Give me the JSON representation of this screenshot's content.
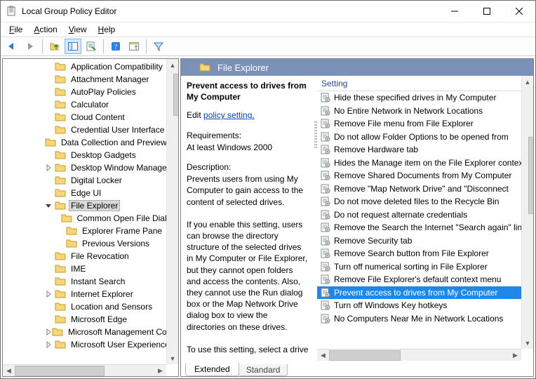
{
  "window": {
    "title": "Local Group Policy Editor"
  },
  "menu": {
    "file": "File",
    "action": "Action",
    "view": "View",
    "help": "Help"
  },
  "category": {
    "label": "File Explorer"
  },
  "desc": {
    "title": "Prevent access to drives from My Computer",
    "edit_prefix": "Edit ",
    "edit_link": "policy setting.",
    "req_header": "Requirements:",
    "req_value": "At least Windows 2000",
    "d_header": "Description:",
    "d_value": "Prevents users from using My Computer to gain access to the content of selected drives.\n\nIf you enable this setting, users can browse the directory structure of the selected drives in My Computer or File Explorer, but they cannot open folders and access the contents. Also, they cannot use the Run dialog box or the Map Network Drive dialog box to view the directories on these drives.\n\nTo use this setting, select a drive"
  },
  "list_header": "Setting",
  "tabs": {
    "extended": "Extended",
    "standard": "Standard"
  },
  "tree": [
    {
      "indent": 4,
      "label": "Application Compatibility",
      "expand": ""
    },
    {
      "indent": 4,
      "label": "Attachment Manager",
      "expand": ""
    },
    {
      "indent": 4,
      "label": "AutoPlay Policies",
      "expand": ""
    },
    {
      "indent": 4,
      "label": "Calculator",
      "expand": ""
    },
    {
      "indent": 4,
      "label": "Cloud Content",
      "expand": ""
    },
    {
      "indent": 4,
      "label": "Credential User Interface",
      "expand": ""
    },
    {
      "indent": 4,
      "label": "Data Collection and Preview Builds",
      "expand": ""
    },
    {
      "indent": 4,
      "label": "Desktop Gadgets",
      "expand": ""
    },
    {
      "indent": 4,
      "label": "Desktop Window Manager",
      "expand": ">"
    },
    {
      "indent": 4,
      "label": "Digital Locker",
      "expand": ""
    },
    {
      "indent": 4,
      "label": "Edge UI",
      "expand": ""
    },
    {
      "indent": 4,
      "label": "File Explorer",
      "expand": "v",
      "selected": true
    },
    {
      "indent": 5,
      "label": "Common Open File Dialog",
      "expand": ""
    },
    {
      "indent": 5,
      "label": "Explorer Frame Pane",
      "expand": ""
    },
    {
      "indent": 5,
      "label": "Previous Versions",
      "expand": ""
    },
    {
      "indent": 4,
      "label": "File Revocation",
      "expand": ""
    },
    {
      "indent": 4,
      "label": "IME",
      "expand": ""
    },
    {
      "indent": 4,
      "label": "Instant Search",
      "expand": ""
    },
    {
      "indent": 4,
      "label": "Internet Explorer",
      "expand": ">"
    },
    {
      "indent": 4,
      "label": "Location and Sensors",
      "expand": ""
    },
    {
      "indent": 4,
      "label": "Microsoft Edge",
      "expand": ""
    },
    {
      "indent": 4,
      "label": "Microsoft Management Console",
      "expand": ">"
    },
    {
      "indent": 4,
      "label": "Microsoft User Experience",
      "expand": ">"
    }
  ],
  "settings": [
    "Hide these specified drives in My Computer",
    "No Entire Network in Network Locations",
    "Remove File menu from File Explorer",
    "Do not allow Folder Options to be opened from",
    "Remove Hardware tab",
    "Hides the Manage item on the File Explorer context menu",
    "Remove Shared Documents from My Computer",
    "Remove \"Map Network Drive\" and \"Disconnect",
    "Do not move deleted files to the Recycle Bin",
    "Do not request alternate credentials",
    "Remove the Search the Internet \"Search again\" link",
    "Remove Security tab",
    "Remove Search button from File Explorer",
    "Turn off numerical sorting in File Explorer",
    "Remove File Explorer's default context menu",
    "Prevent access to drives from My Computer",
    "Turn off Windows Key hotkeys",
    "No Computers Near Me in Network Locations"
  ],
  "settings_selected_index": 15
}
